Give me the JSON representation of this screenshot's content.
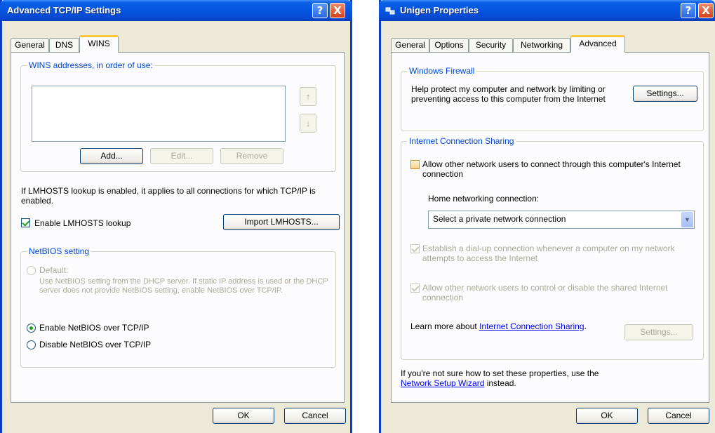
{
  "dialog1": {
    "title": "Advanced TCP/IP Settings",
    "help": "?",
    "close": "X",
    "tabs": [
      "General",
      "DNS",
      "WINS"
    ],
    "wins_group": "WINS addresses, in order of use:",
    "add": "Add...",
    "edit": "Edit...",
    "remove": "Remove",
    "up": "↑",
    "down": "↓",
    "lmhosts_info": "If LMHOSTS lookup is enabled, it applies to all connections for which TCP/IP is enabled.",
    "enable_lmhosts": "Enable LMHOSTS lookup",
    "enable_lmhosts_checked": true,
    "import_lmhosts": "Import LMHOSTS...",
    "netbios_group": "NetBIOS setting",
    "default_label": "Default:",
    "default_desc": "Use NetBIOS setting from the DHCP server. If static IP address is used or the DHCP server does not provide NetBIOS setting, enable NetBIOS over TCP/IP.",
    "enable_netbios": "Enable NetBIOS over TCP/IP",
    "disable_netbios": "Disable NetBIOS over TCP/IP",
    "selected_netbios": "Enable NetBIOS over TCP/IP",
    "ok": "OK",
    "cancel": "Cancel"
  },
  "dialog2": {
    "title": "Unigen Properties",
    "help": "?",
    "close": "X",
    "tabs": [
      "General",
      "Options",
      "Security",
      "Networking",
      "Advanced"
    ],
    "firewall_group": "Windows Firewall",
    "firewall_text": "Help protect my computer and network by limiting or preventing access to this computer from the Internet",
    "settings": "Settings...",
    "ics_group": "Internet Connection Sharing",
    "allow_connect": "Allow other network users to connect through this computer's Internet connection",
    "allow_connect_checked": false,
    "home_label": "Home networking connection:",
    "home_select": "Select a private network connection",
    "dialup": "Establish a dial-up connection whenever a computer on my network attempts to access the Internet",
    "dialup_checked": true,
    "allow_control": "Allow other network users to control or disable the shared Internet connection",
    "allow_control_checked": true,
    "learn_more": "Learn more about",
    "learn_link": "Internet Connection Sharing",
    "learn_end": ".",
    "ics_settings": "Settings...",
    "not_sure": "If you're not sure how to set these properties, use the",
    "wizard_link": "Network Setup Wizard",
    "instead": "instead.",
    "ok": "OK",
    "cancel": "Cancel"
  },
  "colors": {
    "title_bar": "#0655e0",
    "dialog_bg": "#ece9d8",
    "group_label": "#0046d5",
    "tab_highlight": "#ffc83c",
    "check_mark": "#21a121"
  }
}
